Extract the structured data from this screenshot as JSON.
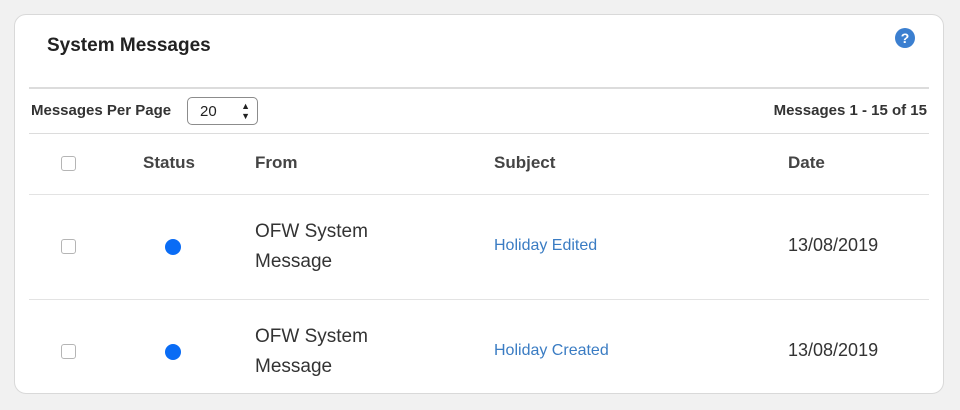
{
  "panel": {
    "title": "System Messages",
    "help_icon": "question-circle-icon",
    "help_glyph": "?"
  },
  "toolbar": {
    "per_page_label": "Messages Per Page",
    "per_page_value": "20",
    "summary": "Messages 1 - 15 of 15"
  },
  "table": {
    "headers": {
      "status": "Status",
      "from": "From",
      "subject": "Subject",
      "date": "Date"
    },
    "rows": [
      {
        "from": "OFW System Message",
        "subject": "Holiday Edited",
        "date": "13/08/2019"
      },
      {
        "from": "OFW System Message",
        "subject": "Holiday Created",
        "date": "13/08/2019"
      }
    ]
  },
  "colors": {
    "accent": "#3b7fd0",
    "status_unread": "#0a6cf5",
    "link": "#3a7cc3"
  }
}
